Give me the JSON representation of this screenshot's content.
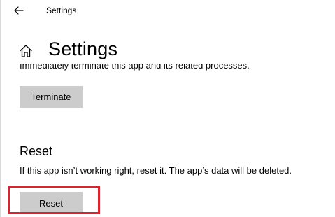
{
  "titlebar": {
    "title": "Settings",
    "back_icon": "arrow-left-icon"
  },
  "header": {
    "home_icon": "home-icon",
    "title": "Settings"
  },
  "terminate_section": {
    "description_partial": "Immediately terminate this app and its related processes.",
    "button_label": "Terminate"
  },
  "reset_section": {
    "heading": "Reset",
    "description": "If this app isn’t working right, reset it. The app’s data will be deleted.",
    "button_label": "Reset"
  },
  "annotation": {
    "highlight_color": "#e0202a",
    "highlight_target": "reset-button"
  }
}
